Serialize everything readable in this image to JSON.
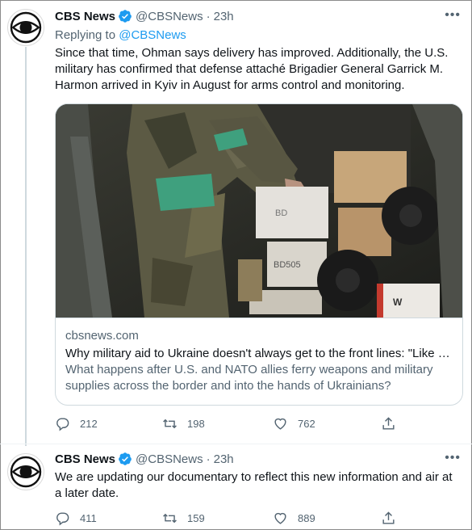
{
  "tweets": [
    {
      "name": "CBS News",
      "handle": "@CBSNews",
      "separator": "·",
      "time": "23h",
      "replying_label": "Replying to",
      "replying_to": "@CBSNews",
      "text": "Since that time, Ohman says delivery has improved. Additionally, the U.S. military has confirmed that defense attaché Brigadier General Garrick M. Harmon arrived in Kyiv in August for arms control and monitoring.",
      "card": {
        "image_labels": [
          "BD",
          "BD505",
          "W"
        ],
        "domain": "cbsnews.com",
        "title": "Why military aid to Ukraine doesn't always get to the front lines: \"Like …",
        "description": "What happens after U.S. and NATO allies ferry weapons and military supplies across the border and into the hands of Ukrainians?"
      },
      "actions": {
        "replies": "212",
        "retweets": "198",
        "likes": "762"
      }
    },
    {
      "name": "CBS News",
      "handle": "@CBSNews",
      "separator": "·",
      "time": "23h",
      "text": "We are updating our documentary to reflect this new information and air at a later date.",
      "actions": {
        "replies": "411",
        "retweets": "159",
        "likes": "889"
      }
    }
  ],
  "colors": {
    "accent": "#1d9bf0",
    "secondary_text": "#536471",
    "primary_text": "#0f1419",
    "border": "#cfd9de"
  },
  "icons": [
    "cbs-eye-logo",
    "verified-badge-icon",
    "more-icon",
    "reply-icon",
    "retweet-icon",
    "like-icon",
    "share-icon"
  ]
}
